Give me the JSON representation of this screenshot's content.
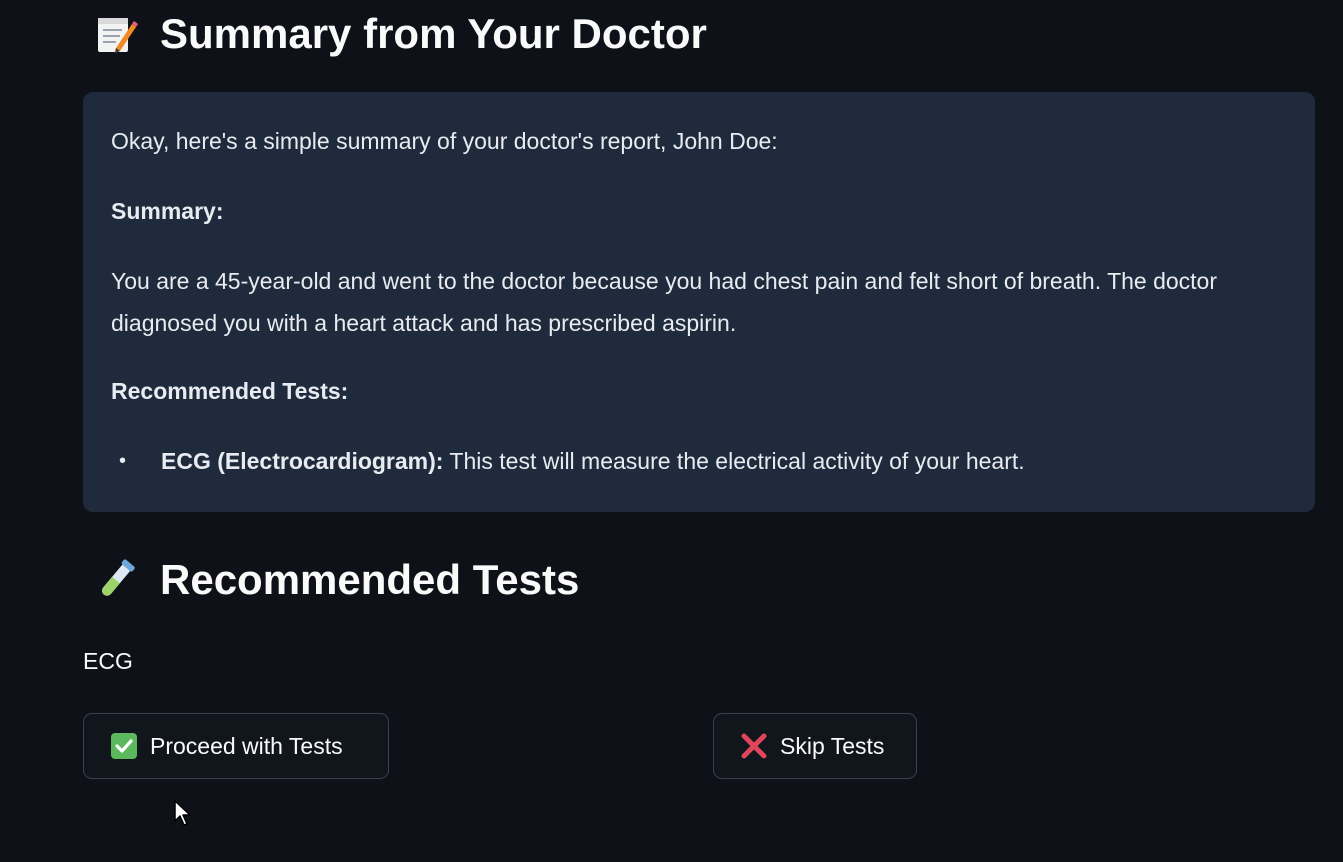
{
  "summary_section": {
    "heading": "Summary from Your Doctor",
    "heading_icon": "memo-icon",
    "intro": "Okay, here's a simple summary of your doctor's report, John Doe:",
    "summary_label": "Summary:",
    "summary_text": "You are a 45-year-old and went to the doctor because you had chest pain and felt short of breath. The doctor diagnosed you with a heart attack and has prescribed aspirin.",
    "recommended_label": "Recommended Tests:",
    "tests": [
      {
        "name": "ECG (Electrocardiogram):",
        "description": " This test will measure the electrical activity of your heart."
      }
    ]
  },
  "tests_section": {
    "heading": "Recommended Tests",
    "heading_icon": "test-tube-icon",
    "test_list": "ECG"
  },
  "actions": {
    "proceed_label": "Proceed with Tests",
    "proceed_icon": "check-mark-icon",
    "skip_label": "Skip Tests",
    "skip_icon": "cross-mark-icon"
  },
  "colors": {
    "background": "#0e1117",
    "summary_box": "#1f2b3c",
    "check_green": "#5cb85c",
    "cross_red": "#e0455a"
  }
}
